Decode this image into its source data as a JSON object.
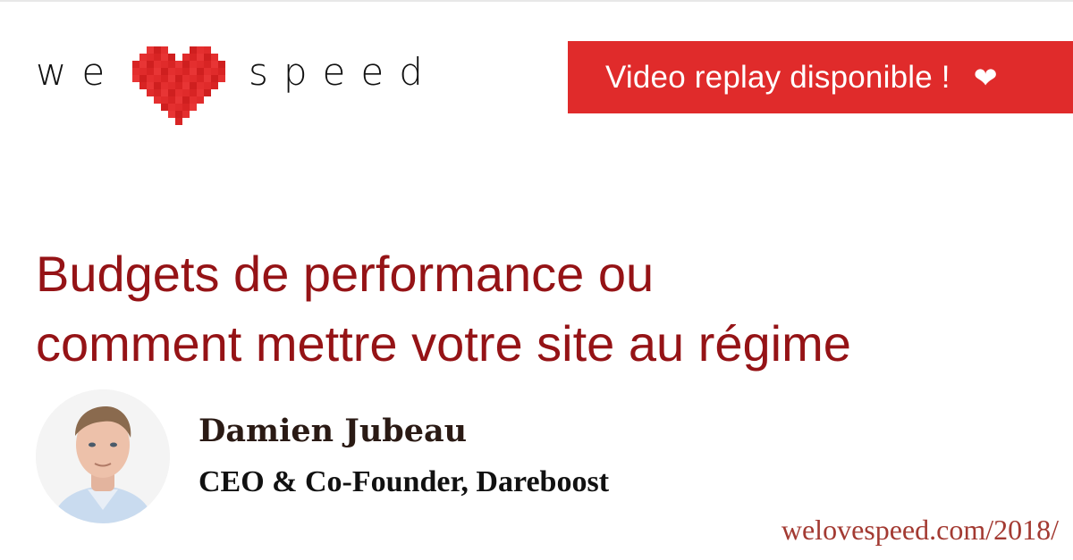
{
  "brand": {
    "word_left": "we",
    "word_right": "speed",
    "heart_icon": "pixel-heart-icon",
    "heart_color": "#e02b2b"
  },
  "banner": {
    "label": "Video replay disponible !",
    "heart": "❤",
    "background": "#e02b2b"
  },
  "talk": {
    "title_line1": "Budgets de performance ou",
    "title_line2": "comment mettre votre site au régime",
    "title_color": "#951316"
  },
  "speaker": {
    "name": "Damien Jubeau",
    "role": "CEO & Co-Founder, Dareboost"
  },
  "footer": {
    "url": "welovespeed.com/2018/"
  }
}
